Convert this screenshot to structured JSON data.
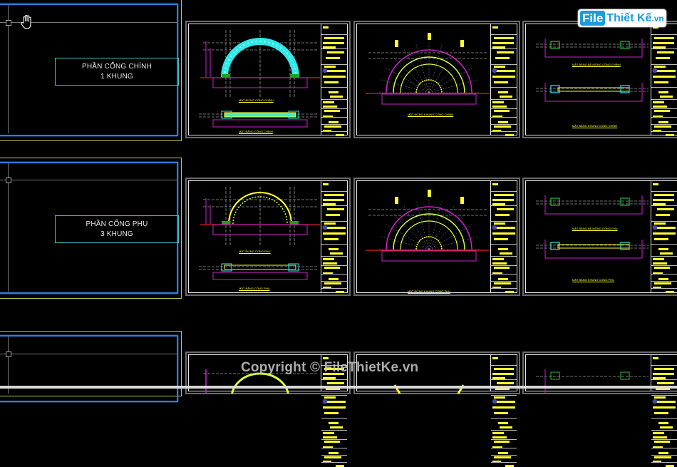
{
  "app": {
    "type": "CAD drawing viewer (model space)"
  },
  "sections": [
    {
      "id": "main-gate",
      "label_line1": "PHẦN CỔNG CHÍNH",
      "label_line2": "1 KHUNG"
    },
    {
      "id": "secondary-gate",
      "label_line1": "PHẦN CỔNG PHỤ",
      "label_line2": "3 KHUNG"
    },
    {
      "id": "third-section",
      "label_line1": "",
      "label_line2": ""
    }
  ],
  "sheets": {
    "row1": [
      {
        "caption_top": "MẶT ĐỨNG CỔNG CHÍNH",
        "caption_bottom": "MẶT BẰNG CỔNG CHÍNH",
        "type": "elevation-arch"
      },
      {
        "caption_top": "MẶT ĐỨNG KHUNG CỔNG CHÍNH",
        "type": "truss-arch"
      },
      {
        "caption_top": "MẶT BẰNG BỂ MÓNG CỔNG CHÍNH",
        "caption_bottom": "MẶT BẰNG KHUNG CỔNG CHÍNH",
        "type": "foundation-plan"
      }
    ],
    "row2": [
      {
        "caption_top": "MẶT ĐỨNG CỔNG PHỤ",
        "caption_bottom": "MẶT BẰNG CỔNG PHỤ",
        "type": "elevation-arch"
      },
      {
        "caption_top": "MẶT ĐỨNG KHUNG CỔNG PHỤ",
        "type": "truss-arch"
      },
      {
        "caption_top": "MẶT BẰNG BỂ MÓNG CỔNG PHỤ",
        "caption_bottom": "MẶT BẰNG KHUNG CỔNG PHỤ",
        "type": "foundation-plan"
      }
    ]
  },
  "cursor": {
    "icon": "pan-hand-icon"
  },
  "watermark": {
    "brand_part1": "File",
    "brand_part2": "Thiết Kế",
    "brand_suffix": ".vn"
  },
  "copyright": "Copyright © FileThietKe.vn",
  "colors": {
    "background": "#000000",
    "frame_yellow": "#c8c060",
    "frame_blue": "#2a7fe0",
    "label_cyan": "#3fc0c8",
    "cad_yellow": "#ffff30",
    "cad_magenta": "#d020d0",
    "cad_cyan": "#30e8e8",
    "cad_red": "#e02020",
    "cad_green": "#20a020",
    "brand_blue": "#1e9ad8"
  }
}
